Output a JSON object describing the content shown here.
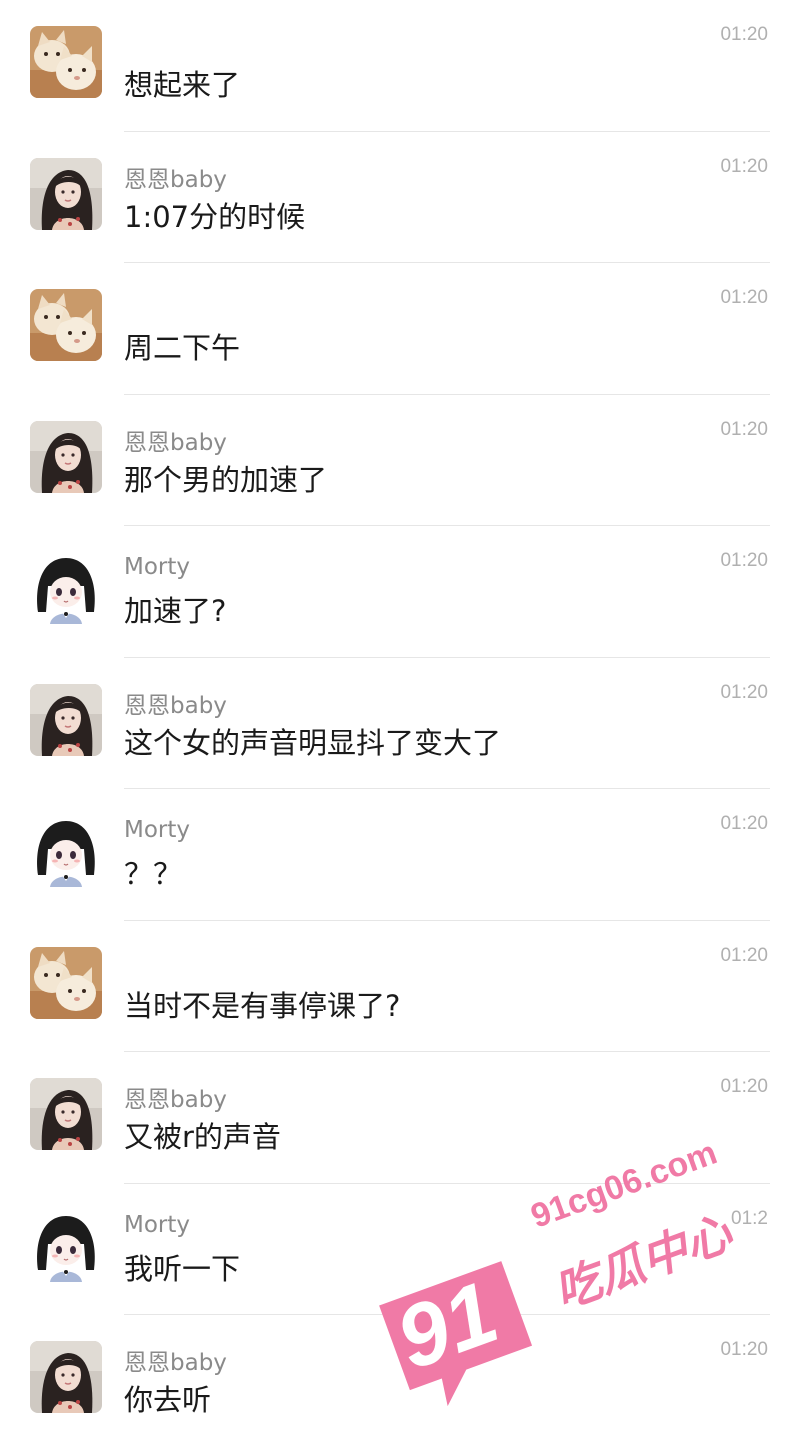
{
  "messages": [
    {
      "avatar": "cat-avatar",
      "name": "",
      "text": "想起来了",
      "time": "01:20"
    },
    {
      "avatar": "girl-photo-avatar",
      "name": "恩恩baby",
      "text": "1:07分的时候",
      "time": "01:20"
    },
    {
      "avatar": "cat-avatar",
      "name": "",
      "text": "周二下午",
      "time": "01:20"
    },
    {
      "avatar": "girl-photo-avatar",
      "name": "恩恩baby",
      "text": "那个男的加速了",
      "time": "01:20"
    },
    {
      "avatar": "anime-girl-avatar",
      "name": "Morty",
      "text": "加速了?",
      "time": "01:20"
    },
    {
      "avatar": "girl-photo-avatar",
      "name": "恩恩baby",
      "text": "这个女的声音明显抖了变大了",
      "time": "01:20"
    },
    {
      "avatar": "anime-girl-avatar",
      "name": "Morty",
      "text": "？？",
      "time": "01:20"
    },
    {
      "avatar": "cat-avatar",
      "name": "",
      "text": "当时不是有事停课了?",
      "time": "01:20"
    },
    {
      "avatar": "girl-photo-avatar",
      "name": "恩恩baby",
      "text": "又被r的声音",
      "time": "01:20"
    },
    {
      "avatar": "anime-girl-avatar",
      "name": "Morty",
      "text": "我听一下",
      "time": "01:2"
    },
    {
      "avatar": "girl-photo-avatar",
      "name": "恩恩baby",
      "text": "你去听",
      "time": "01:20"
    }
  ],
  "watermark": {
    "number": "91",
    "domain": "91cg06.com",
    "label": "吃瓜中心",
    "color": "#f07aa6"
  }
}
